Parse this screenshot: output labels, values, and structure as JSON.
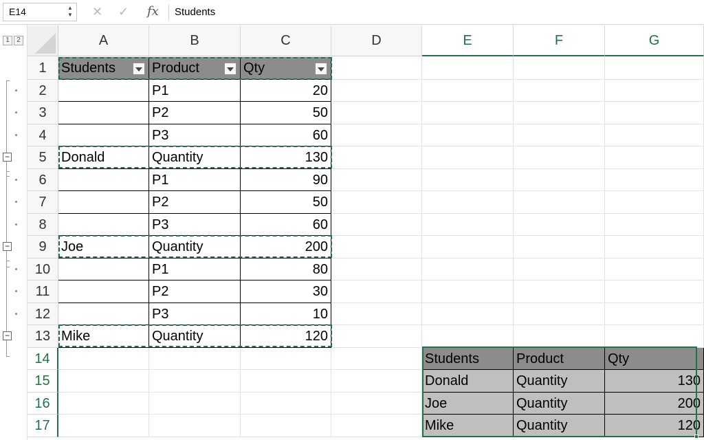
{
  "formula_bar": {
    "name_box": "E14",
    "name_box_arrows": "▲▼",
    "cancel_icon": "✕",
    "enter_icon": "✓",
    "fx_label": "fx",
    "content": "Students"
  },
  "outline": {
    "levels": [
      "1",
      "2"
    ],
    "collapse_glyph": "−"
  },
  "columns": [
    "A",
    "B",
    "C",
    "D",
    "E",
    "F",
    "G"
  ],
  "selected_columns": [
    "E",
    "F",
    "G"
  ],
  "rows": [
    "1",
    "2",
    "3",
    "4",
    "5",
    "6",
    "7",
    "8",
    "9",
    "10",
    "11",
    "12",
    "13",
    "14",
    "15",
    "16",
    "17"
  ],
  "selected_rows": [
    "14",
    "15",
    "16",
    "17"
  ],
  "source_table": {
    "headers": [
      "Students",
      "Product",
      "Qty"
    ],
    "rows": [
      [
        "",
        "P1",
        "20"
      ],
      [
        "",
        "P2",
        "50"
      ],
      [
        "",
        "P3",
        "60"
      ],
      [
        "Donald",
        "Quantity",
        "130"
      ],
      [
        "",
        "P1",
        "90"
      ],
      [
        "",
        "P2",
        "50"
      ],
      [
        "",
        "P3",
        "60"
      ],
      [
        "Joe",
        "Quantity",
        "200"
      ],
      [
        "",
        "P1",
        "80"
      ],
      [
        "",
        "P2",
        "30"
      ],
      [
        "",
        "P3",
        "10"
      ],
      [
        "Mike",
        "Quantity",
        "120"
      ]
    ]
  },
  "result_table": {
    "headers": [
      "Students",
      "Product",
      "Qty"
    ],
    "rows": [
      [
        "Donald",
        "Quantity",
        "130"
      ],
      [
        "Joe",
        "Quantity",
        "200"
      ],
      [
        "Mike",
        "Quantity",
        "120"
      ]
    ]
  },
  "colors": {
    "accent": "#217346",
    "header_fill": "#8c8c8c",
    "result_fill": "#bfbfbf"
  }
}
